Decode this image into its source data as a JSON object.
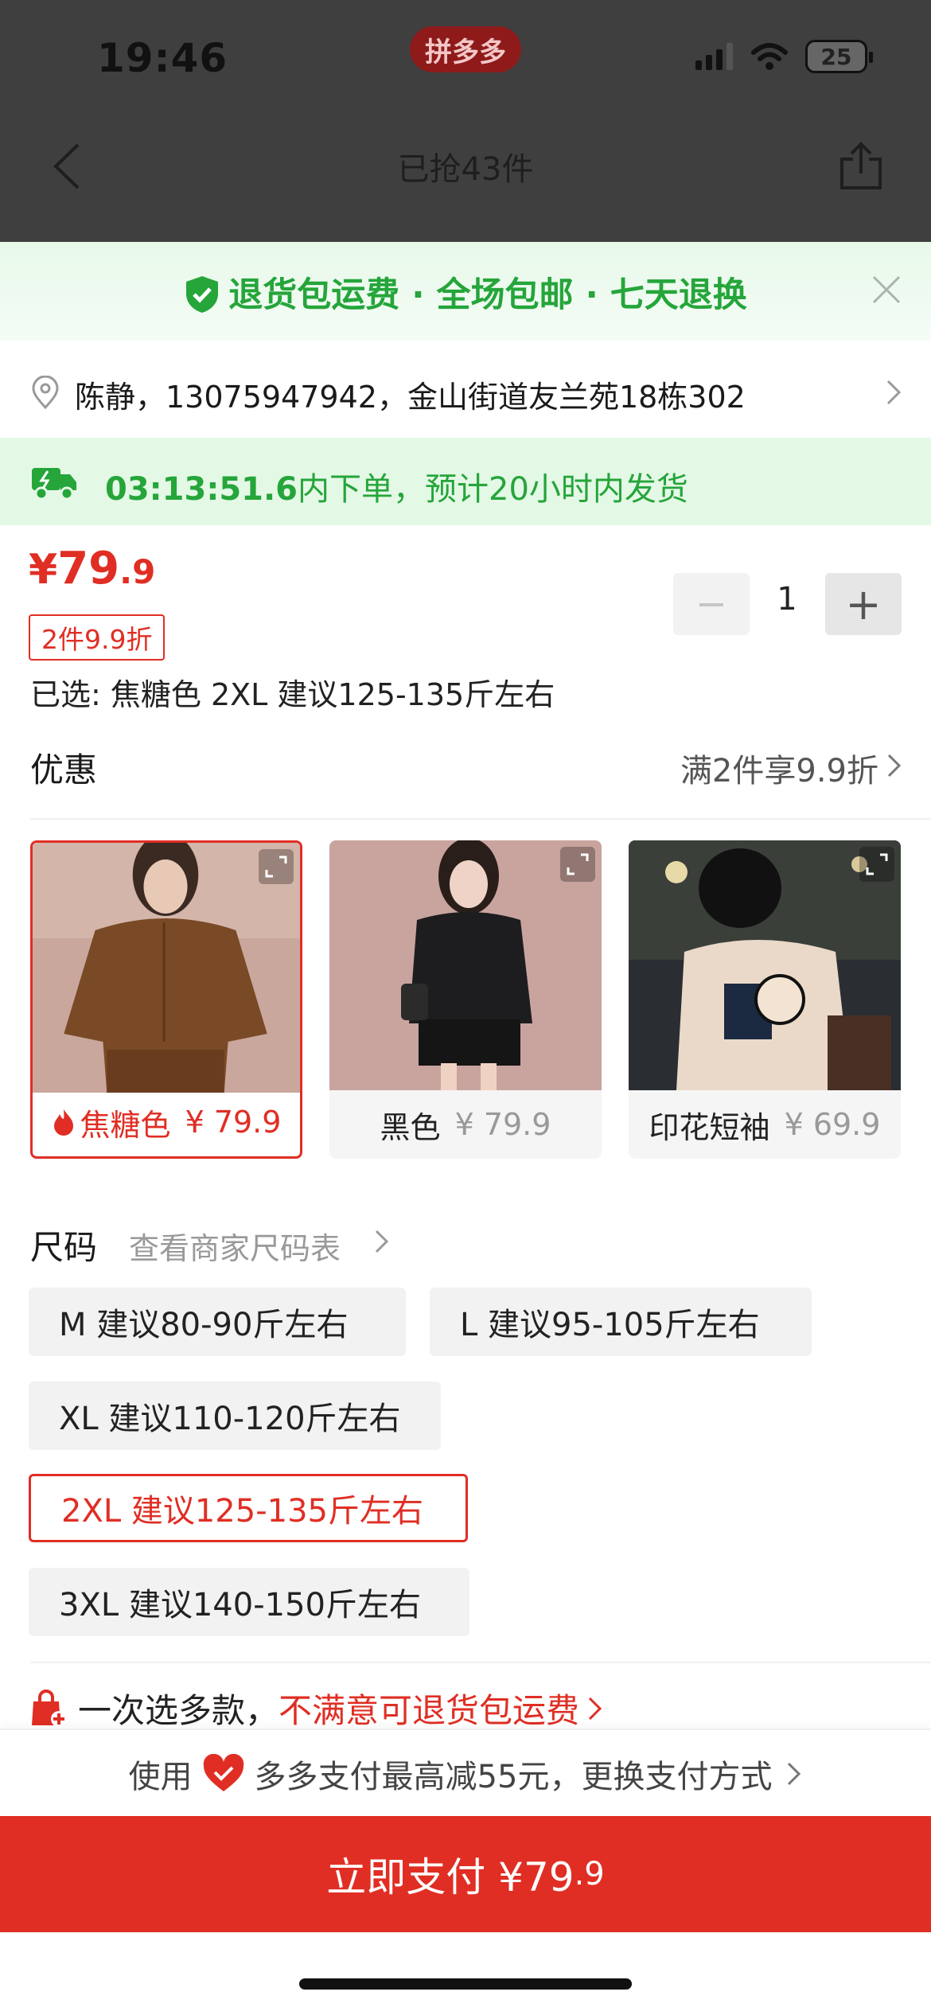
{
  "status_bar": {
    "time": "19:46",
    "app_pill": "拼多多",
    "battery": "25"
  },
  "nav": {
    "title": "已抢43件"
  },
  "banner": {
    "text": "退货包运费 · 全场包邮 · 七天退换"
  },
  "address": {
    "text": "陈静，13075947942，金山街道友兰苑18栋302"
  },
  "shipping": {
    "countdown": "03:13:51.6",
    "text": "内下单，预计20小时内发货"
  },
  "price": {
    "currency": "¥",
    "integer": "79",
    "decimal": ".9",
    "discount_tag": "2件9.9折"
  },
  "selection": {
    "text": "已选: 焦糖色 2XL 建议125-135斤左右"
  },
  "quantity": {
    "minus": "−",
    "value": "1",
    "plus": "+"
  },
  "promo": {
    "label": "优惠",
    "value": "满2件享9.9折"
  },
  "colors": [
    {
      "name": "焦糖色",
      "price": "¥ 79.9",
      "selected": true
    },
    {
      "name": "黑色",
      "price": "¥ 79.9",
      "selected": false
    },
    {
      "name": "印花短袖",
      "price": "¥ 69.9",
      "selected": false
    }
  ],
  "size": {
    "label": "尺码",
    "chart_link": "查看商家尺码表",
    "options": [
      {
        "label": "M 建议80-90斤左右",
        "selected": false
      },
      {
        "label": "L 建议95-105斤左右",
        "selected": false
      },
      {
        "label": "XL 建议110-120斤左右",
        "selected": false
      },
      {
        "label": "2XL 建议125-135斤左右",
        "selected": true
      },
      {
        "label": "3XL 建议140-150斤左右",
        "selected": false
      }
    ]
  },
  "multi": {
    "text_a": "一次选多款，",
    "text_b": "不满意可退货包运费"
  },
  "pay_method": {
    "prefix": "使用",
    "text": "多多支付最高减55元，更换支付方式"
  },
  "pay_button": {
    "label": "立即支付 ¥79",
    "decimal": ".9"
  },
  "colors_theme": {
    "accent_red": "#e02e24",
    "accent_green": "#25a53a"
  }
}
